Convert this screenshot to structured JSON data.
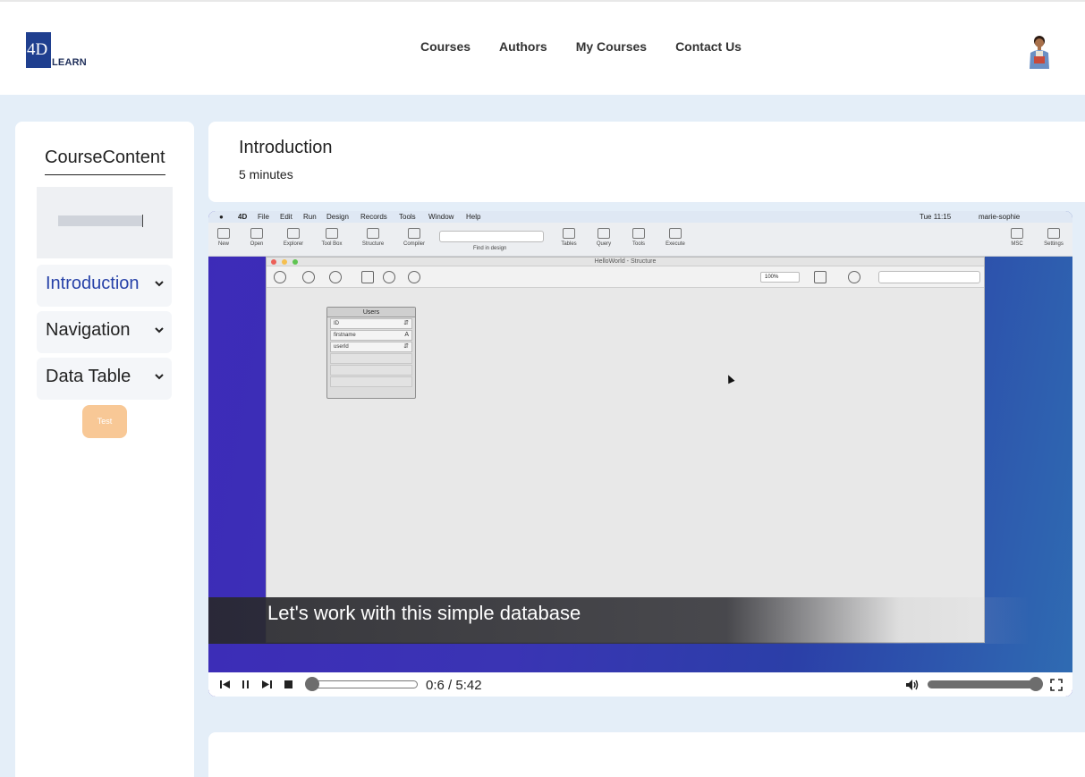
{
  "header": {
    "logo_mark": "4D",
    "logo_text": "LEARN",
    "nav": [
      "Courses",
      "Authors",
      "My Courses",
      "Contact Us"
    ]
  },
  "sidebar": {
    "title": "CourseContent",
    "items": [
      {
        "label": "Introduction",
        "active": true
      },
      {
        "label": "Navigation",
        "active": false
      },
      {
        "label": "Data Table",
        "active": false
      }
    ],
    "test_button": "Test"
  },
  "lesson": {
    "title": "Introduction",
    "duration": "5 minutes"
  },
  "video": {
    "menubar": {
      "app": "4D",
      "menus": [
        "File",
        "Edit",
        "Run",
        "Design",
        "Records",
        "Tools",
        "Window",
        "Help"
      ],
      "clock": "Tue 11:15",
      "user": "marie-sophie"
    },
    "toolbar": [
      "New",
      "Open",
      "Explorer",
      "Tool Box",
      "Structure",
      "Compiler",
      "Tables",
      "Query",
      "Tools",
      "Execute",
      "MSC",
      "Settings"
    ],
    "toolbar_search_label": "Find in design",
    "window_title": "HelloWorld - Structure",
    "zoom": "100%",
    "table": {
      "name": "Users",
      "fields": [
        {
          "name": "ID",
          "type": "⇵"
        },
        {
          "name": "firstname",
          "type": "A"
        },
        {
          "name": "userId",
          "type": "⇵"
        }
      ]
    },
    "subtitle": "Let's work with this simple database",
    "time": "0:6 / 5:42",
    "progress": 0.02,
    "volume": 1.0
  },
  "colors": {
    "accent": "#2742a8",
    "page_bg": "#e4eef8",
    "test_button": "#f8c896"
  }
}
